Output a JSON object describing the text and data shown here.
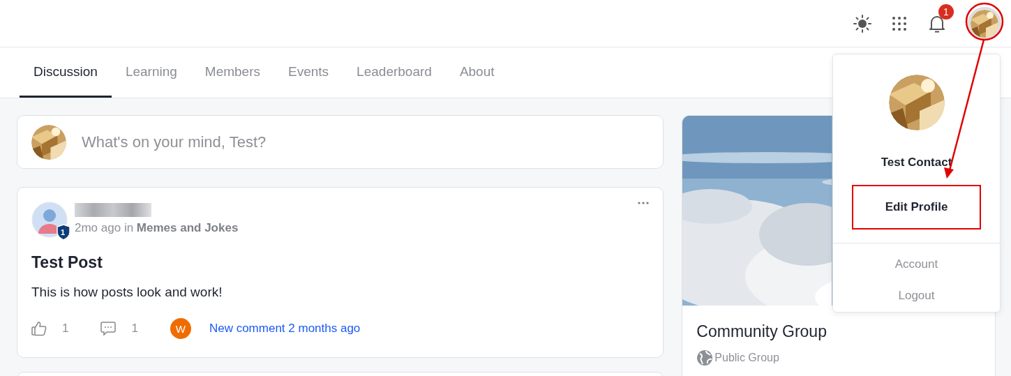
{
  "header": {
    "notification_count": "1"
  },
  "tabs": [
    {
      "label": "Discussion",
      "selected": true
    },
    {
      "label": "Learning",
      "selected": false
    },
    {
      "label": "Members",
      "selected": false
    },
    {
      "label": "Events",
      "selected": false
    },
    {
      "label": "Leaderboard",
      "selected": false
    },
    {
      "label": "About",
      "selected": false
    }
  ],
  "composer": {
    "placeholder": "What's on your mind, Test?"
  },
  "post": {
    "rank_badge": "1",
    "meta": "2mo ago in",
    "group": "Memes and Jokes",
    "title": "Test Post",
    "body": "This is how posts look and work!",
    "likes": "1",
    "comments": "1",
    "commenter_initial": "W",
    "latest_comment": "New comment 2 months ago"
  },
  "group_card": {
    "name": "Community Group",
    "privacy": "Public Group"
  },
  "profile_menu": {
    "name": "Test Contact",
    "items": [
      {
        "label": "Edit Profile",
        "emphasized": true,
        "annotated": true
      },
      {
        "label": "Account",
        "emphasized": false,
        "annotated": false
      },
      {
        "label": "Logout",
        "emphasized": false,
        "annotated": false
      }
    ]
  }
}
